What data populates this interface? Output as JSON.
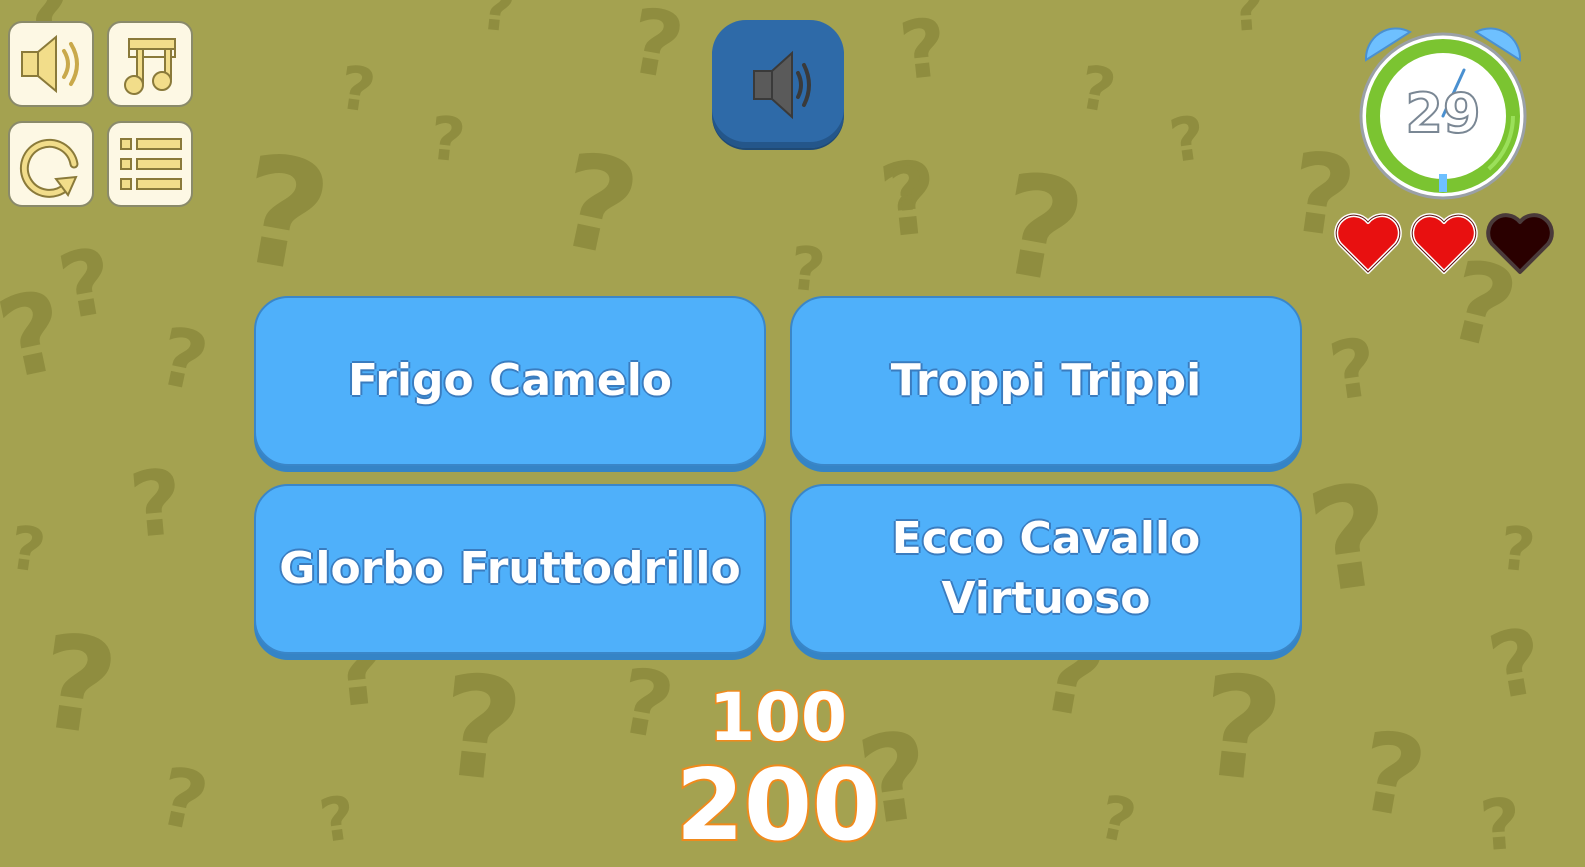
{
  "controls": [
    {
      "name": "sound-toggle-button",
      "icon": "speaker-icon"
    },
    {
      "name": "music-toggle-button",
      "icon": "music-note-icon"
    },
    {
      "name": "restart-button",
      "icon": "restart-icon"
    },
    {
      "name": "menu-button",
      "icon": "list-icon"
    }
  ],
  "question": {
    "icon": "speaker-icon",
    "color": "#2e6aa8"
  },
  "timer": {
    "seconds": "29",
    "ring_color": "#7bc431",
    "accent_color": "#6ec0ff"
  },
  "lives": {
    "total": 3,
    "remaining": 2,
    "full_color": "#e81010",
    "empty_color": "#2a0000"
  },
  "answers": [
    {
      "label": "Frigo Camelo"
    },
    {
      "label": "Troppi Trippi"
    },
    {
      "label": "Glorbo Fruttodrillo"
    },
    {
      "label": "Ecco Cavallo Virtuoso"
    }
  ],
  "score": {
    "points_gain": "100",
    "total": "200",
    "outline_color": "#f08a1c"
  },
  "colors": {
    "background": "#a4a250",
    "answer_button": "#4fb0fa"
  }
}
